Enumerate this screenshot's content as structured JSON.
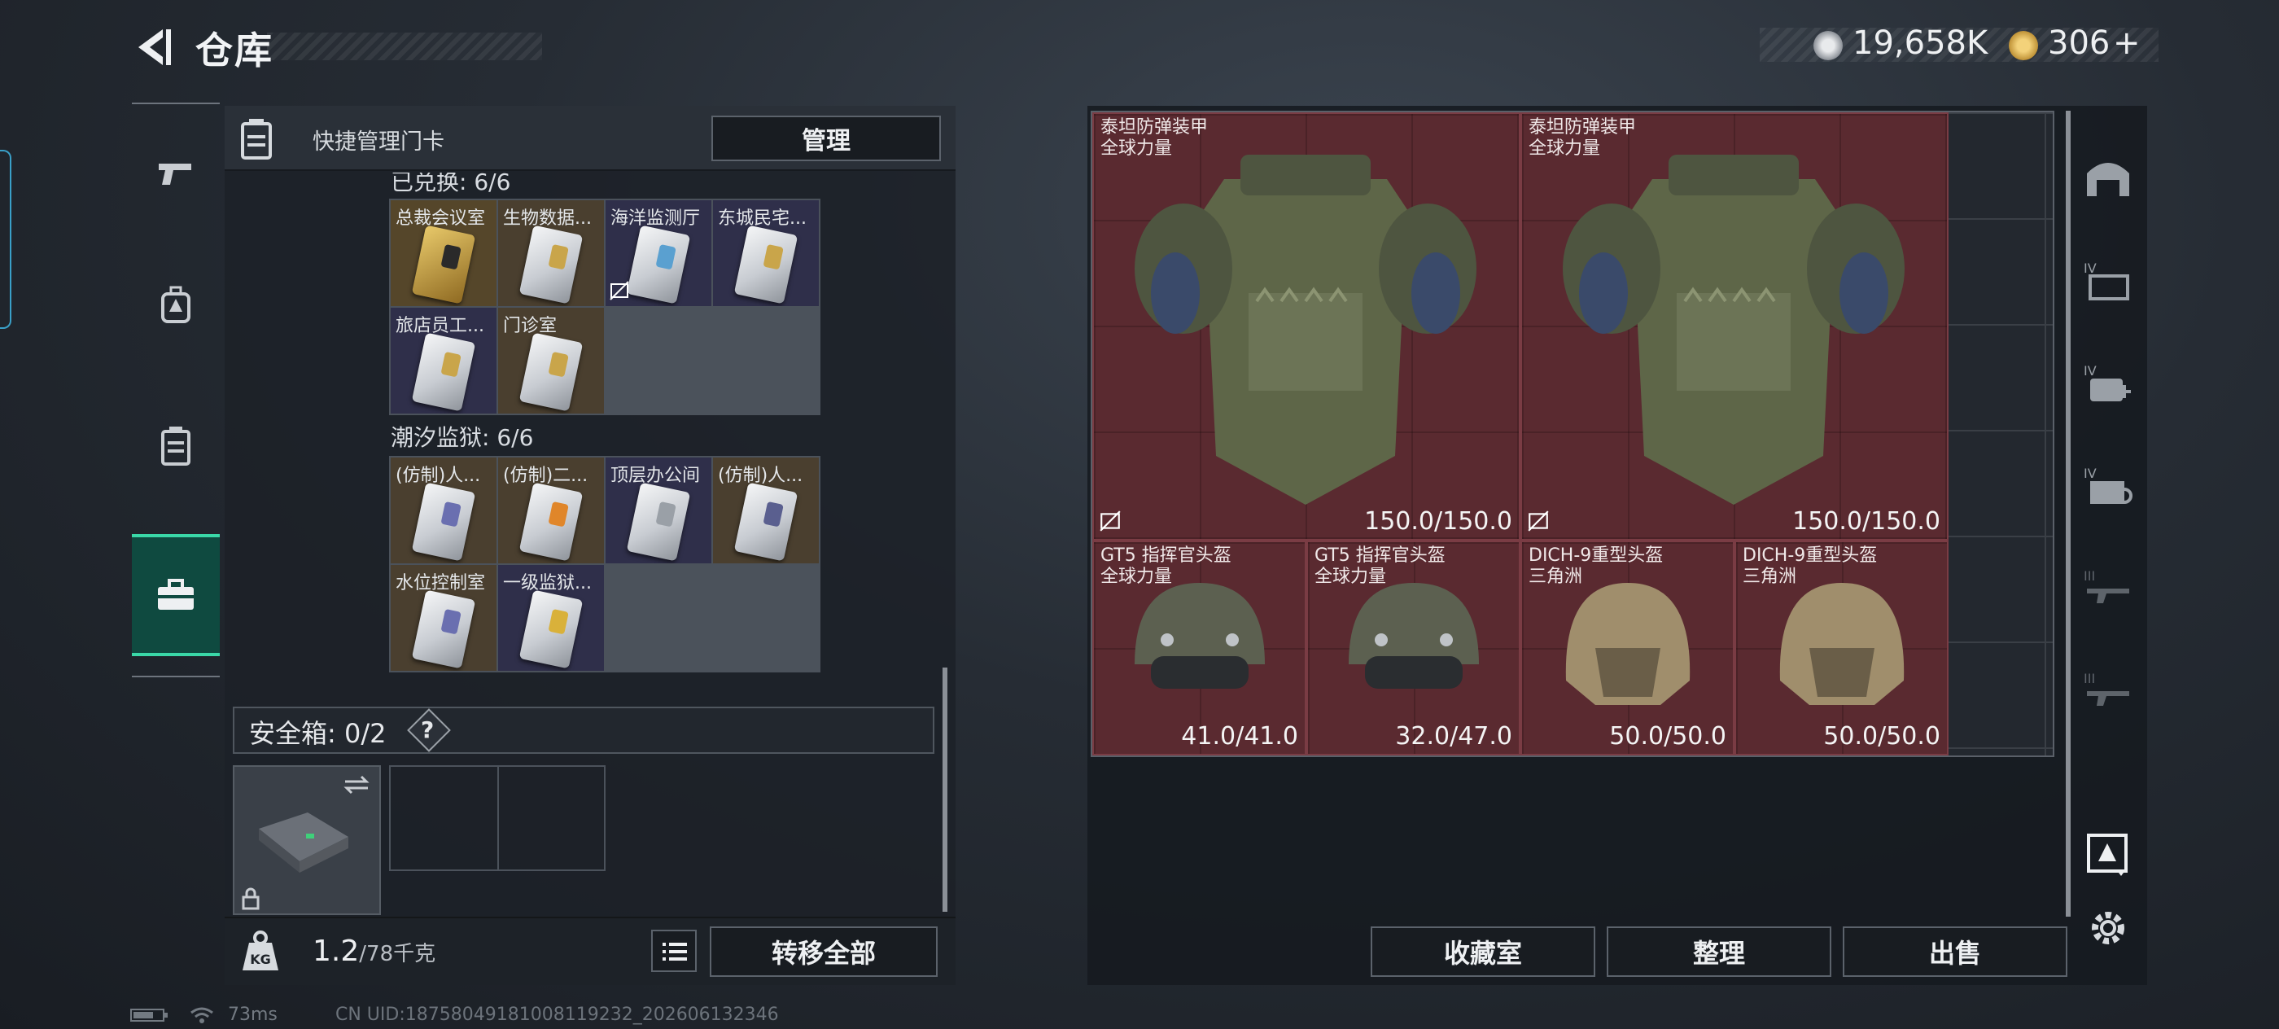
{
  "header": {
    "title": "仓库",
    "currency_1": "19,658K",
    "currency_2": "306",
    "currency_2_add": "+"
  },
  "left_panel": {
    "head_label": "快捷管理门卡",
    "manage_button": "管理",
    "section_1": "已兑换: 6/6",
    "section_1_cards": [
      "总裁会议室",
      "生物数据...",
      "海洋监测厅",
      "东城民宅...",
      "旅店员工...",
      "门诊室"
    ],
    "section_2": "潮汐监狱: 6/6",
    "section_2_cards": [
      "(仿制)人...",
      "(仿制)二...",
      "顶层办公间",
      "(仿制)人...",
      "水位控制室",
      "一级监狱..."
    ],
    "safebox_label": "安全箱: 0/2",
    "help_label": "?",
    "weight_value": "1.2",
    "weight_max": "/78千克",
    "transfer_all_button": "转移全部"
  },
  "stash": {
    "items": [
      {
        "name": "泰坦防弹装甲",
        "sub": "全球力量",
        "durability": "150.0/150.0"
      },
      {
        "name": "泰坦防弹装甲",
        "sub": "全球力量",
        "durability": "150.0/150.0"
      },
      {
        "name": "GT5 指挥官头盔",
        "sub": "全球力量",
        "durability": "41.0/41.0"
      },
      {
        "name": "GT5 指挥官头盔",
        "sub": "全球力量",
        "durability": "32.0/47.0"
      },
      {
        "name": "DICH-9重型头盔",
        "sub": "三角洲",
        "durability": "50.0/50.0"
      },
      {
        "name": "DICH-9重型头盔",
        "sub": "三角洲",
        "durability": "50.0/50.0"
      }
    ],
    "collection_button": "收藏室",
    "sort_button": "整理",
    "sell_button": "出售"
  },
  "filters": [
    "IV",
    "IV",
    "IV",
    "III",
    "III"
  ],
  "status": {
    "ping": "73ms",
    "uid": "CN UID:18758049181008119232_202606132346"
  },
  "colors": {
    "accent": "#3ad8a8",
    "item_bg": "#5a2a30"
  }
}
